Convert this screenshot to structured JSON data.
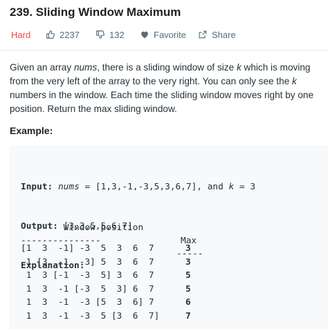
{
  "problem": {
    "title": "239. Sliding Window Maximum",
    "difficulty": "Hard",
    "likes": "2237",
    "dislikes": "132",
    "favorite_label": "Favorite",
    "share_label": "Share"
  },
  "description": {
    "segments": [
      {
        "text": "Given an array ",
        "style": "normal"
      },
      {
        "text": "nums",
        "style": "italic"
      },
      {
        "text": ", there is a sliding window of size ",
        "style": "normal"
      },
      {
        "text": "k",
        "style": "italic"
      },
      {
        "text": " which is moving from the very left of the array to the very right. You can only see the ",
        "style": "normal"
      },
      {
        "text": "k",
        "style": "italic"
      },
      {
        "text": " numbers in the window. Each time the sliding window moves right by one position. Return the max sliding window.",
        "style": "normal"
      }
    ]
  },
  "example": {
    "heading": "Example:",
    "input_label": "Input:",
    "input_var": "nums",
    "input_eq": " = ",
    "input_value": "[1,3,-1,-3,5,3,6,7]",
    "input_and": ", and ",
    "input_k": "k",
    "input_k_value": " = 3",
    "output_label": "Output:",
    "output_value": " [3,3,5,5,6,7]",
    "explanation_label": "Explanation:",
    "table": {
      "header_window": "Window position",
      "header_max": "Max",
      "dash_left": "---------------",
      "dash_right": "-----",
      "rows": [
        {
          "window": "[1  3  -1] -3  5  3  6  7",
          "max": "3"
        },
        {
          "window": " 1 [3  -1  -3] 5  3  6  7",
          "max": "3"
        },
        {
          "window": " 1  3 [-1  -3  5] 3  6  7",
          "max": "5"
        },
        {
          "window": " 1  3  -1 [-3  5  3] 6  7",
          "max": "5"
        },
        {
          "window": " 1  3  -1  -3 [5  3  6] 7",
          "max": "6"
        },
        {
          "window": " 1  3  -1  -3  5 [3  6  7]",
          "max": "7"
        }
      ]
    }
  },
  "colors": {
    "difficulty_hard": "#ef4743",
    "meta_gray": "#546e7a",
    "example_bg": "#f7f9fa"
  },
  "icons": [
    "thumbs-up-icon",
    "thumbs-down-icon",
    "heart-icon",
    "share-icon"
  ]
}
